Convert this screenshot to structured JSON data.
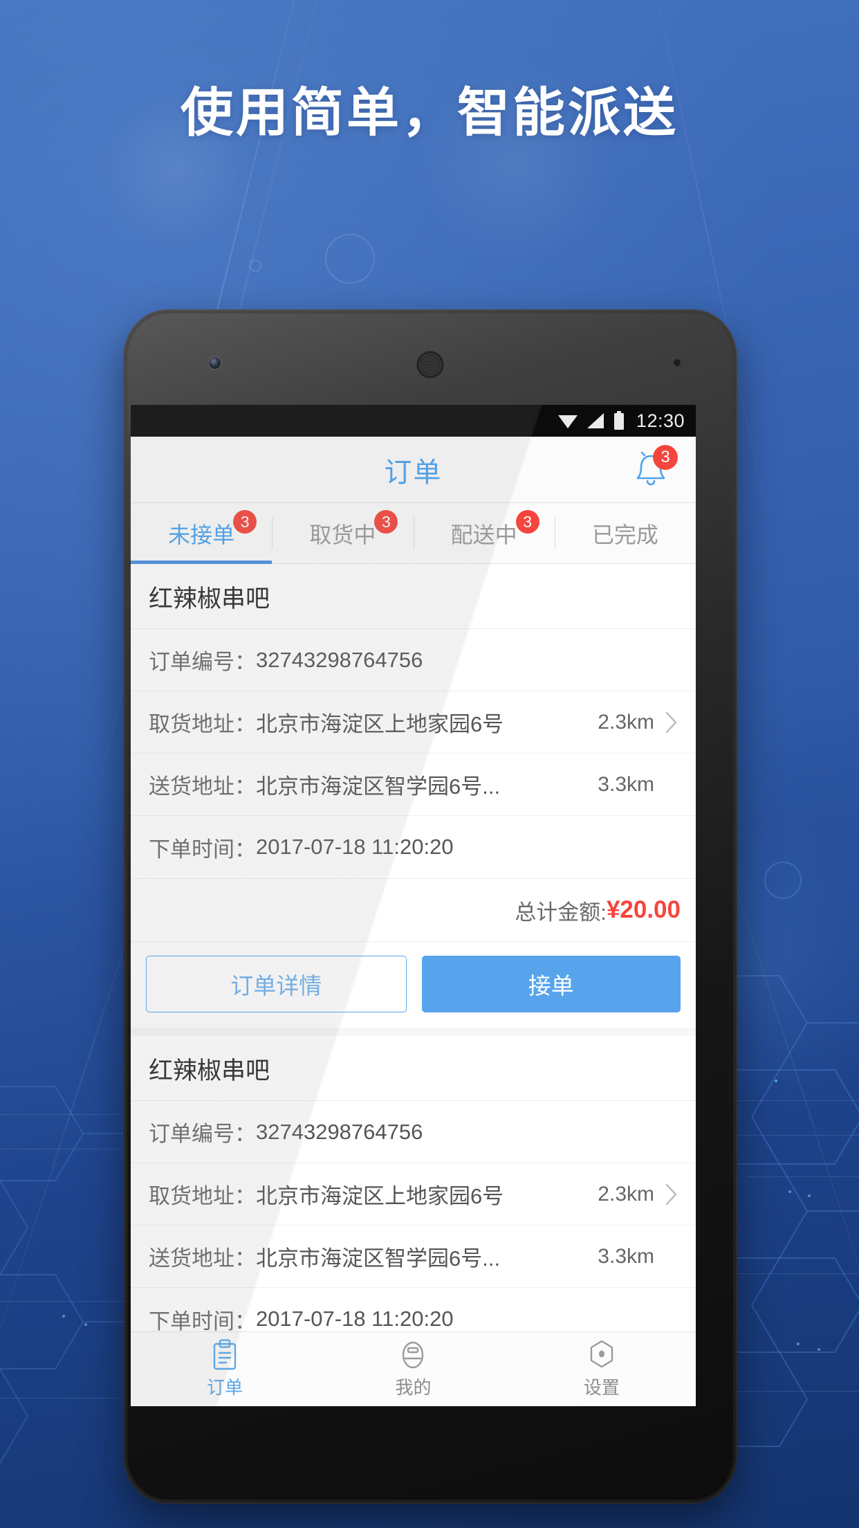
{
  "promo": {
    "headline": "使用简单，智能派送",
    "background_color": "#3a66b5",
    "accent_color": "#4aa3f0"
  },
  "status_bar": {
    "clock": "12:30",
    "wifi_icon": "wifi-icon",
    "signal_icon": "signal-icon",
    "battery_icon": "battery-icon"
  },
  "app_header": {
    "title": "订单",
    "bell_icon": "bell-icon",
    "bell_badge": "3"
  },
  "tabs": [
    {
      "label": "未接单",
      "badge": "3",
      "active": true
    },
    {
      "label": "取货中",
      "badge": "3",
      "active": false
    },
    {
      "label": "配送中",
      "badge": "3",
      "active": false
    },
    {
      "label": "已完成",
      "badge": "",
      "active": false
    }
  ],
  "orders": [
    {
      "shop": "红辣椒串吧",
      "order_no_label": "订单编号：",
      "order_no": "32743298764756",
      "pickup_label": "取货地址：",
      "pickup_address": "北京市海淀区上地家园6号",
      "pickup_distance": "2.3km",
      "delivery_label": "送货地址：",
      "delivery_address": "北京市海淀区智学园6号...",
      "delivery_distance": "3.3km",
      "time_label": "下单时间：",
      "time_value": "2017-07-18  11:20:20",
      "amount_label": "总计金额:",
      "amount_value": "¥20.00",
      "detail_button": "订单详情",
      "accept_button": "接单"
    },
    {
      "shop": "红辣椒串吧",
      "order_no_label": "订单编号：",
      "order_no": "32743298764756",
      "pickup_label": "取货地址：",
      "pickup_address": "北京市海淀区上地家园6号",
      "pickup_distance": "2.3km",
      "delivery_label": "送货地址：",
      "delivery_address": "北京市海淀区智学园6号...",
      "delivery_distance": "3.3km",
      "time_label": "下单时间：",
      "time_value": "2017-07-18  11:20:20"
    }
  ],
  "bottom_nav": [
    {
      "label": "订单",
      "icon": "clipboard-icon",
      "active": true
    },
    {
      "label": "我的",
      "icon": "person-icon",
      "active": false
    },
    {
      "label": "设置",
      "icon": "settings-hex-icon",
      "active": false
    }
  ]
}
